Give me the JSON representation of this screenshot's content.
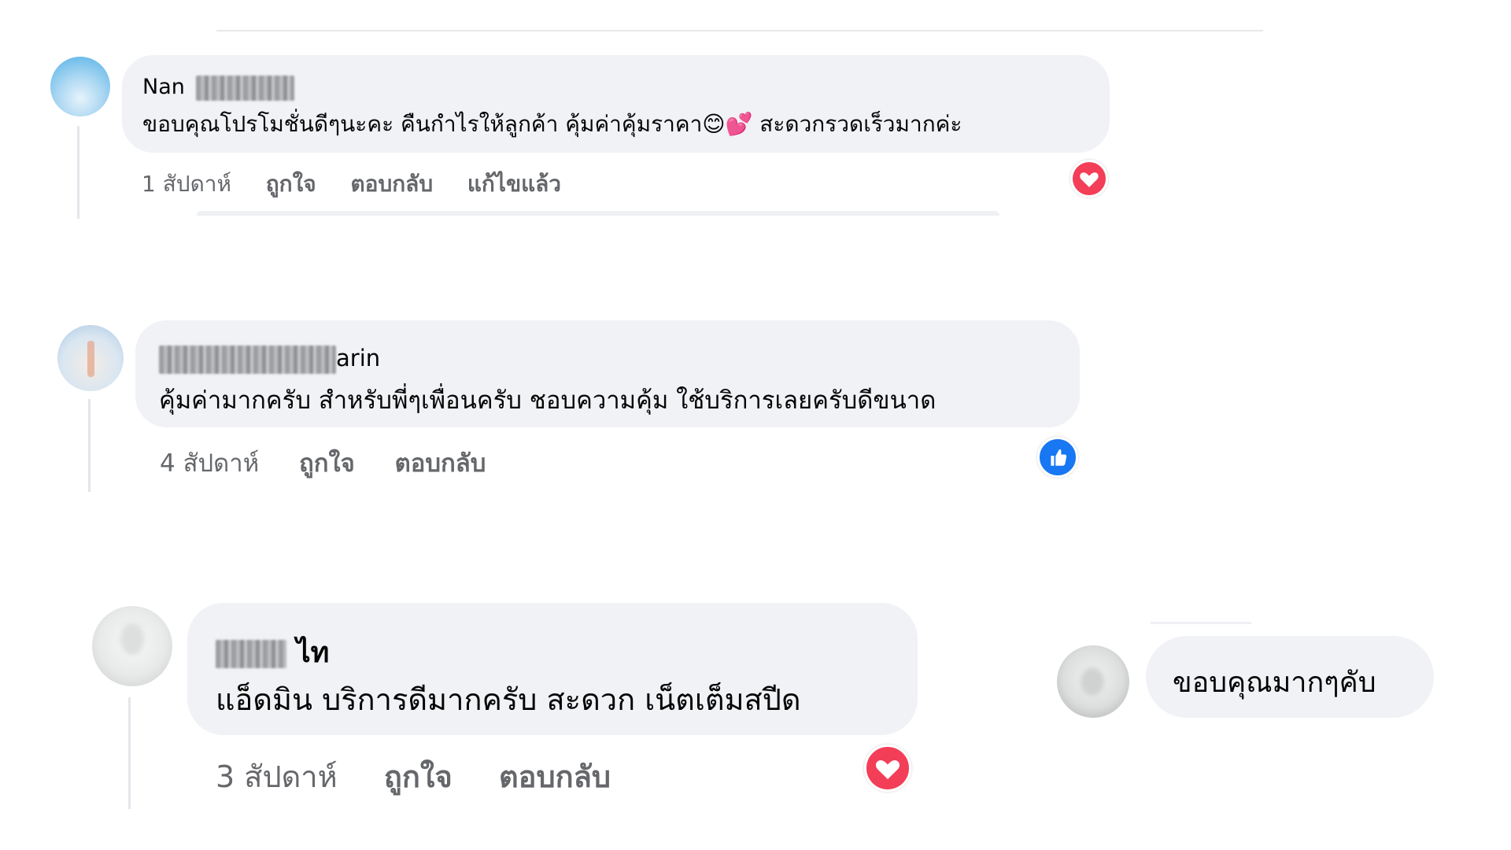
{
  "colors": {
    "bubble_bg": "#f0f2f5",
    "meta_text": "#65676b",
    "love_red": "#f33e58",
    "like_blue": "#1877f2"
  },
  "comments": [
    {
      "author_visible": "Nan",
      "author_redacted": true,
      "text": "ขอบคุณโปรโมชั่นดีๆนะคะ คืนกำไรให้ลูกค้า คุ้มค่าคุ้มราคา😊💕 สะดวกรวดเร็วมากค่ะ",
      "time": "1 สัปดาห์",
      "like_label": "ถูกใจ",
      "reply_label": "ตอบกลับ",
      "edited_label": "แก้ไขแล้ว",
      "reaction_icon": "love-reaction-icon"
    },
    {
      "author_visible": "arin",
      "author_redacted": true,
      "text": "คุ้มค่ามากครับ สำหรับพี่ๆเพื่อนครับ ชอบความคุ้ม ใช้บริการเลยครับดีขนาด",
      "time": "4 สัปดาห์",
      "like_label": "ถูกใจ",
      "reply_label": "ตอบกลับ",
      "reaction_icon": "like-reaction-icon"
    },
    {
      "author_visible": "ไท",
      "author_redacted": true,
      "text": "แอ็ดมิน บริการดีมากครับ สะดวก เน็ตเต็มสปีด",
      "time": "3 สัปดาห์",
      "like_label": "ถูกใจ",
      "reply_label": "ตอบกลับ",
      "reaction_icon": "love-reaction-icon"
    }
  ],
  "reply": {
    "text": "ขอบคุณมากๆคับ"
  }
}
